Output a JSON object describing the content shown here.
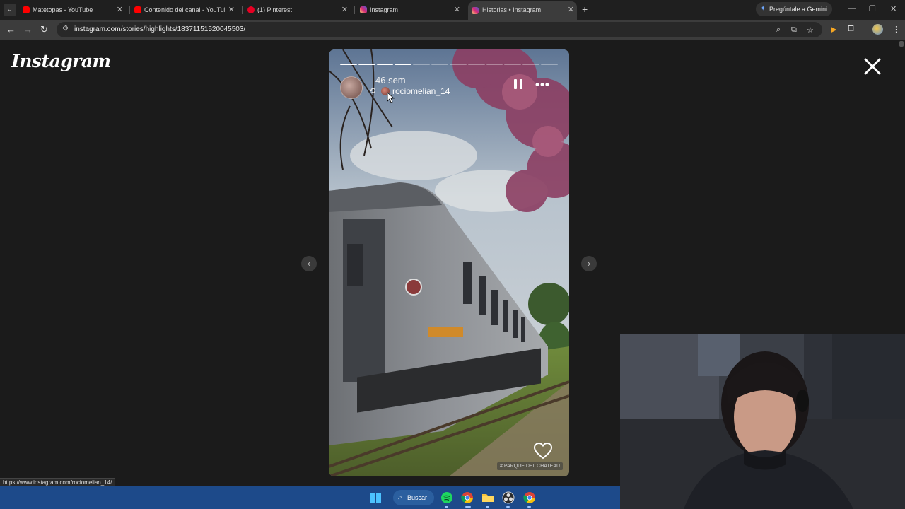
{
  "browser": {
    "tabs": [
      {
        "title": "Matetopas - YouTube",
        "icon": "youtube-icon",
        "color": "#ff0000",
        "active": false
      },
      {
        "title": "Contenido del canal - YouTube",
        "icon": "youtube-icon",
        "color": "#ff0000",
        "active": false
      },
      {
        "title": "(1) Pinterest",
        "icon": "pinterest-icon",
        "color": "#e60023",
        "active": false
      },
      {
        "title": "Instagram",
        "icon": "instagram-icon",
        "color": "#d6249f",
        "active": false
      },
      {
        "title": "Historias • Instagram",
        "icon": "instagram-icon",
        "color": "#d6249f",
        "active": true
      }
    ],
    "gemini_label": "Pregúntale a Gemini",
    "url": "instagram.com/stories/highlights/18371151520045503/"
  },
  "page": {
    "logo": "Instagram",
    "story": {
      "progress_total": 12,
      "progress_done": 4,
      "time": "46 sem",
      "username": "rociomelian_14",
      "location_tag": "# PARQUE DEL CHATEAU"
    }
  },
  "status_url": "https://www.instagram.com/rociomelian_14/",
  "taskbar": {
    "search_label": "Buscar"
  },
  "colors": {
    "accent": "#1d4a8a",
    "page_bg": "#1b1b1b"
  }
}
